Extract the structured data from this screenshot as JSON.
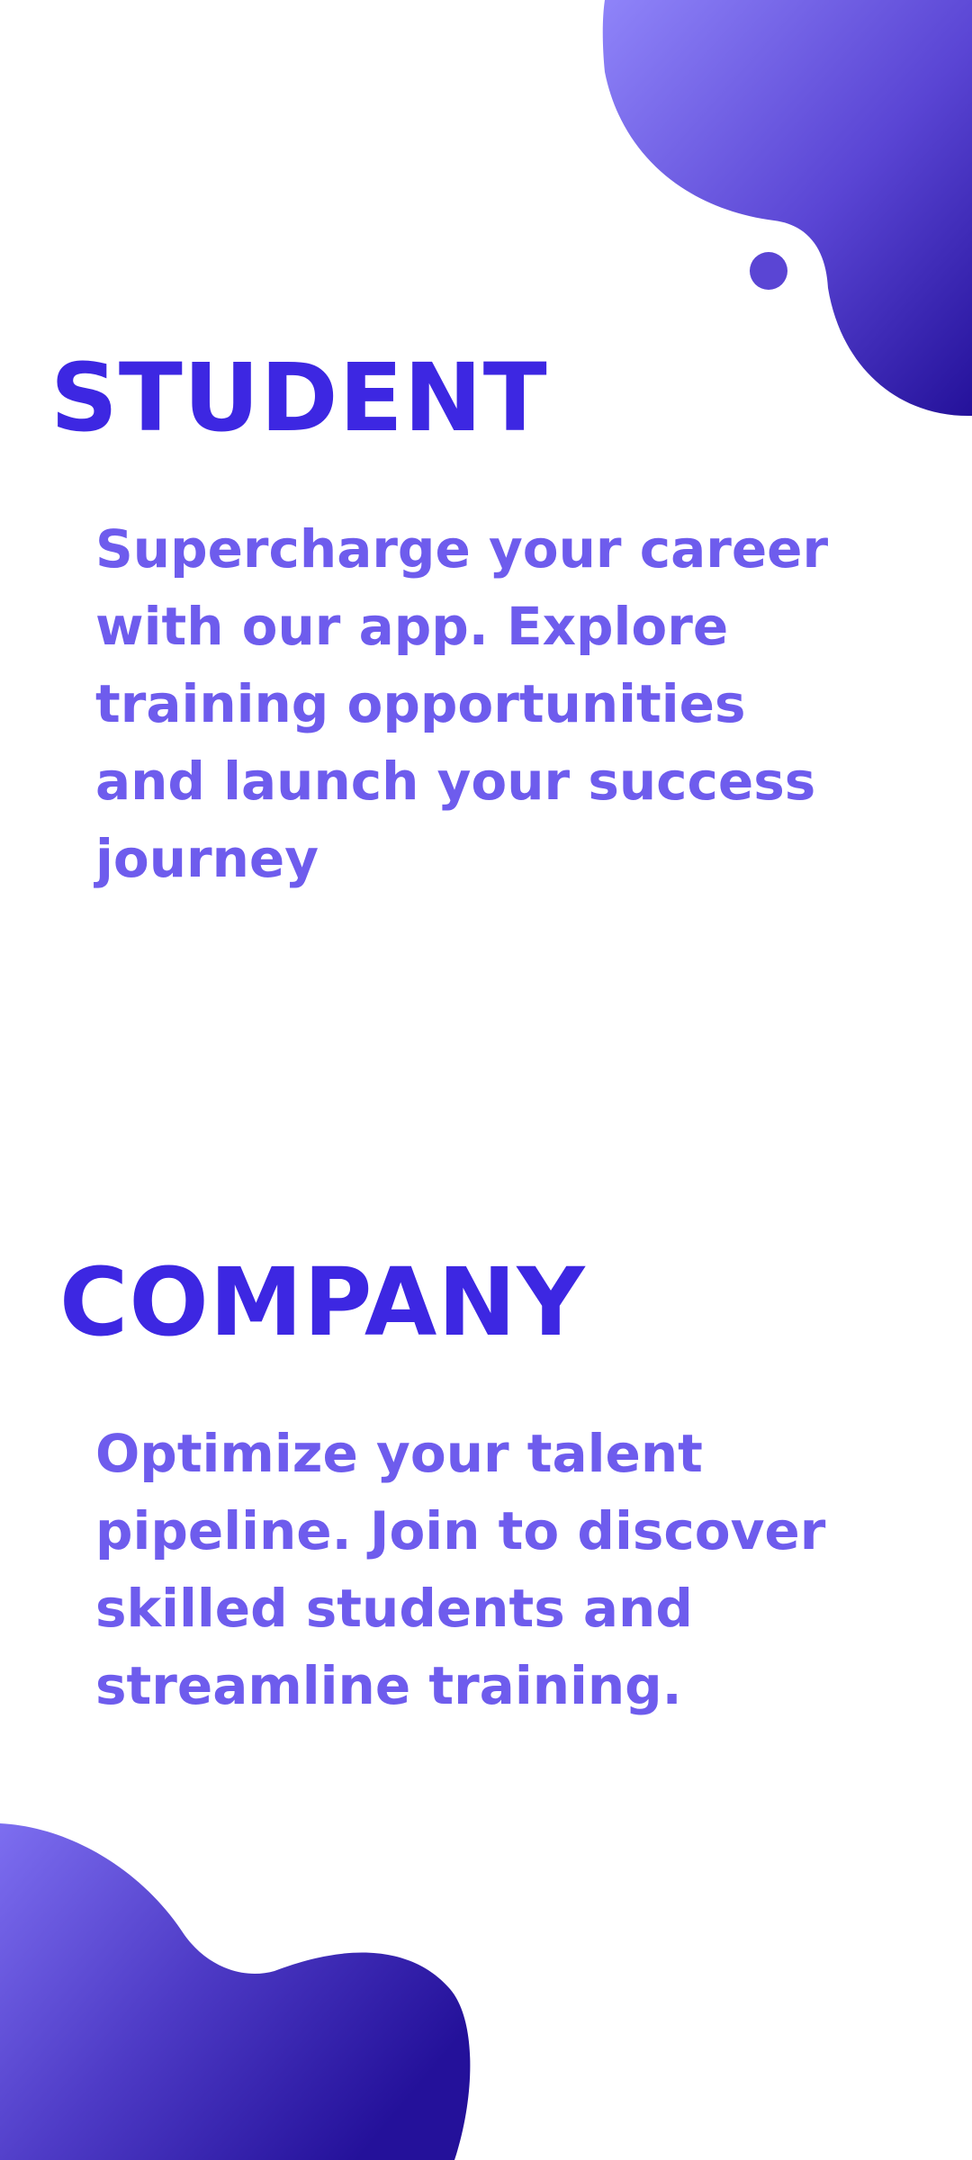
{
  "student": {
    "title": "STUDENT",
    "description": "Supercharge your career with our app. Explore training opportunities and launch your success journey"
  },
  "company": {
    "title": "COMPANY",
    "description": "Optimize your talent pipeline. Join to discover skilled students and streamline training."
  },
  "colors": {
    "title": "#3d27e2",
    "body_text": "#6e5ced",
    "gradient_light": "#8f84f9",
    "gradient_dark": "#24119a",
    "background": "#ffffff"
  }
}
